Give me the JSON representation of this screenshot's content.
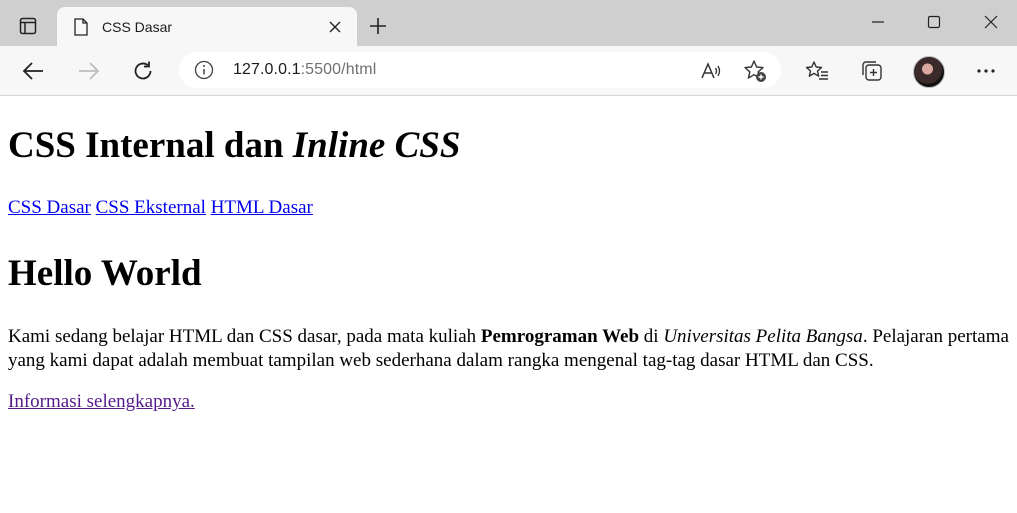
{
  "browser": {
    "tab_title": "CSS Dasar",
    "url_host": "127.0.0.1",
    "url_rest": ":5500/html",
    "icons": [
      "tab-actions-icon",
      "page-icon",
      "close-icon",
      "plus-icon",
      "minimize-icon",
      "maximize-icon",
      "close-window-icon",
      "back-arrow-icon",
      "forward-arrow-icon",
      "refresh-icon",
      "info-icon",
      "read-aloud-icon",
      "add-favorite-icon",
      "favorites-icon",
      "collections-icon",
      "avatar",
      "more-icon"
    ]
  },
  "page": {
    "heading1_main": "CSS Internal dan ",
    "heading1_italic": "Inline CSS",
    "nav": [
      {
        "label": "CSS Dasar"
      },
      {
        "label": "CSS Eksternal"
      },
      {
        "label": "HTML Dasar"
      }
    ],
    "heading2": "Hello World",
    "paragraph": {
      "part1": "Kami sedang belajar HTML dan CSS dasar, pada mata kuliah ",
      "bold": "Pemrograman Web",
      "part2": " di ",
      "italic": "Universitas Pelita Bangsa",
      "part3": ". Pelajaran pertama yang kami dapat adalah membuat tampilan web sederhana dalam rangka mengenal tag-tag dasar HTML dan CSS."
    },
    "more_link": "Informasi selengkapnya."
  },
  "colors": {
    "link": "#0000ee",
    "visited_link": "#551a8b",
    "tabbar_bg": "#cfcfcf",
    "toolbar_bg": "#f7f7f7"
  }
}
